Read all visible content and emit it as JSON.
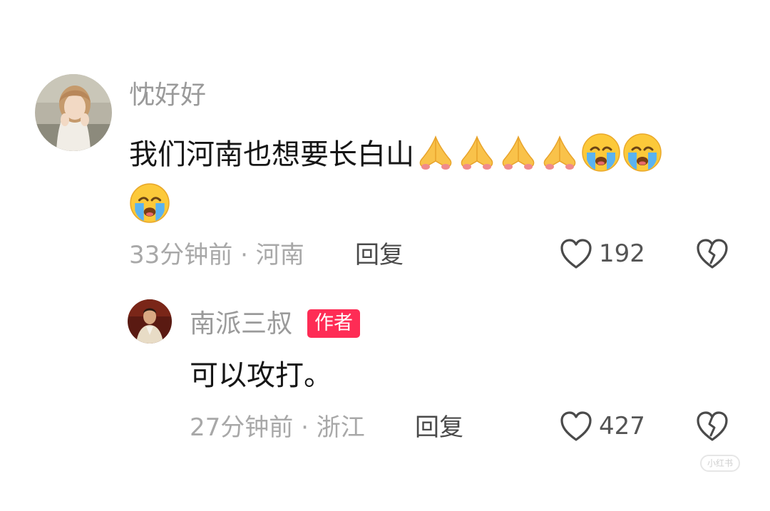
{
  "comment": {
    "username": "忱好好",
    "text": "我们河南也想要长白山",
    "emojis": [
      "pray-emoji",
      "pray-emoji",
      "pray-emoji",
      "pray-emoji",
      "crying-emoji",
      "crying-emoji",
      "crying-emoji"
    ],
    "time": "33分钟前",
    "location": "河南",
    "meta_separator": " · ",
    "reply_label": "回复",
    "like_count": "192"
  },
  "reply": {
    "username": "南派三叔",
    "badge": "作者",
    "text": "可以攻打。",
    "time": "27分钟前",
    "location": "浙江",
    "meta_separator": " · ",
    "reply_label": "回复",
    "like_count": "427"
  },
  "watermark": {
    "text": "小红书"
  },
  "colors": {
    "badge": "#fe2c55",
    "username": "#9a9a9a",
    "text": "#161616",
    "meta": "#a8a8a8"
  }
}
